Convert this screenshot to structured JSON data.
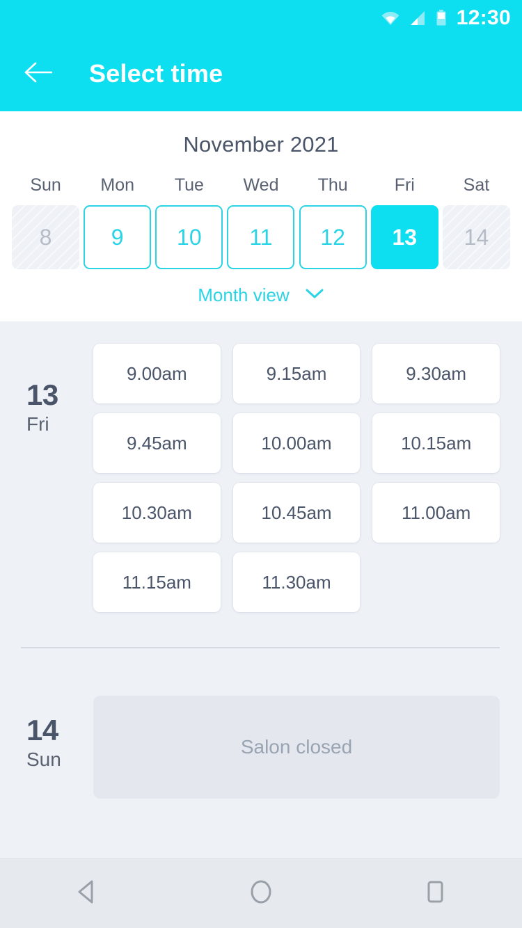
{
  "statusbar": {
    "time": "12:30",
    "icons": [
      "wifi-icon",
      "signal-icon",
      "battery-icon"
    ]
  },
  "appbar": {
    "back_icon": "back-arrow-icon",
    "title": "Select time"
  },
  "calendar": {
    "month_title": "November 2021",
    "day_names": [
      "Sun",
      "Mon",
      "Tue",
      "Wed",
      "Thu",
      "Fri",
      "Sat"
    ],
    "dates": [
      {
        "day": "8",
        "state": "disabled"
      },
      {
        "day": "9",
        "state": "available"
      },
      {
        "day": "10",
        "state": "available"
      },
      {
        "day": "11",
        "state": "available"
      },
      {
        "day": "12",
        "state": "available"
      },
      {
        "day": "13",
        "state": "selected"
      },
      {
        "day": "14",
        "state": "disabled"
      }
    ],
    "month_view_label": "Month view",
    "month_view_icon": "chevron-down-icon"
  },
  "schedule": [
    {
      "date_number": "13",
      "date_dow": "Fri",
      "slots": [
        "9.00am",
        "9.15am",
        "9.30am",
        "9.45am",
        "10.00am",
        "10.15am",
        "10.30am",
        "10.45am",
        "11.00am",
        "11.15am",
        "11.30am"
      ]
    },
    {
      "date_number": "14",
      "date_dow": "Sun",
      "closed_message": "Salon closed"
    }
  ],
  "navbar": {
    "back_icon": "nav-back-triangle-icon",
    "home_icon": "nav-home-circle-icon",
    "recents_icon": "nav-recents-square-icon"
  },
  "colors": {
    "accent": "#0ddff0",
    "accent_border": "#2ad4e4",
    "text_dark": "#4b5569",
    "text_muted": "#9aa3b2",
    "bg_page": "#eef1f6",
    "bg_card": "#ffffff",
    "bg_closed": "#e4e8ee",
    "navbar": "#e6e9ee"
  }
}
